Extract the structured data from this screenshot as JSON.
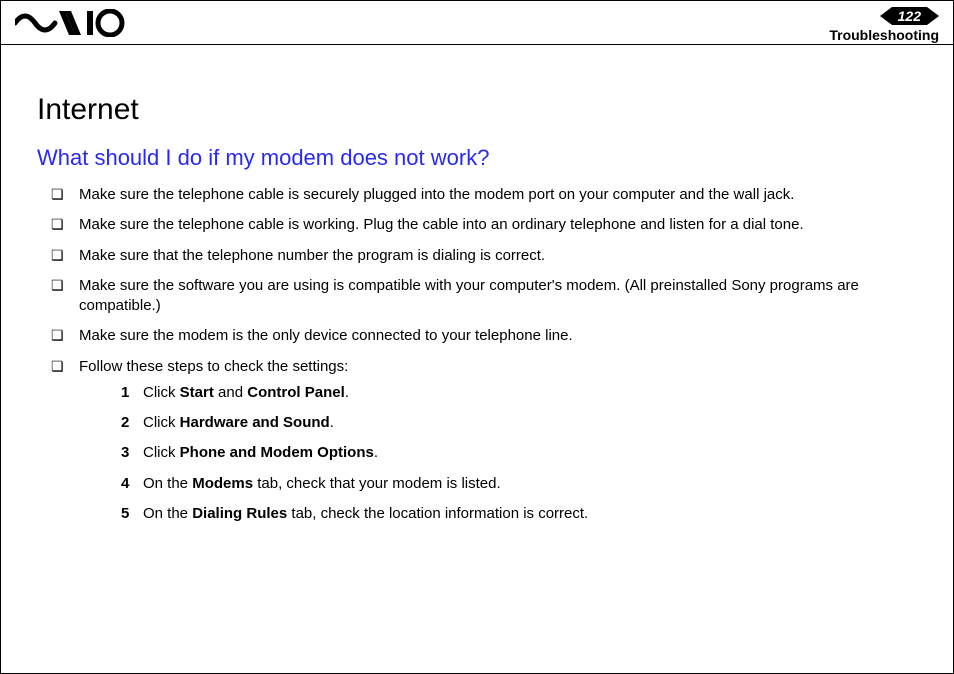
{
  "header": {
    "page_number": "122",
    "section": "Troubleshooting"
  },
  "title": "Internet",
  "question": "What should I do if my modem does not work?",
  "bullets": [
    "Make sure the telephone cable is securely plugged into the modem port on your computer and the wall jack.",
    "Make sure the telephone cable is working. Plug the cable into an ordinary telephone and listen for a dial tone.",
    "Make sure that the telephone number the program is dialing is correct.",
    "Make sure the software you are using is compatible with your computer's modem. (All preinstalled Sony programs are compatible.)",
    "Make sure the modem is the only device connected to your telephone line.",
    "Follow these steps to check the settings:"
  ],
  "steps": [
    {
      "n": "1",
      "pre": "Click ",
      "bold1": "Start",
      "mid": " and ",
      "bold2": "Control Panel",
      "post": "."
    },
    {
      "n": "2",
      "pre": "Click ",
      "bold1": "Hardware and Sound",
      "mid": "",
      "bold2": "",
      "post": "."
    },
    {
      "n": "3",
      "pre": "Click ",
      "bold1": "Phone and Modem Options",
      "mid": "",
      "bold2": "",
      "post": "."
    },
    {
      "n": "4",
      "pre": "On the ",
      "bold1": "Modems",
      "mid": " tab, check that your modem is listed.",
      "bold2": "",
      "post": ""
    },
    {
      "n": "5",
      "pre": "On the ",
      "bold1": "Dialing Rules",
      "mid": " tab, check the location information is correct.",
      "bold2": "",
      "post": ""
    }
  ]
}
